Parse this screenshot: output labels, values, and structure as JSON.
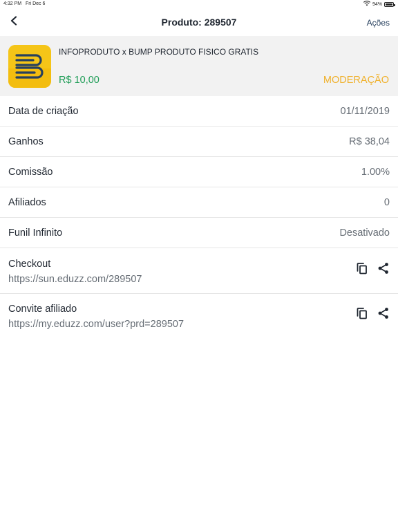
{
  "status_bar": {
    "time": "4:32 PM",
    "date": "Fri Dec 6",
    "battery": "94%"
  },
  "nav": {
    "title": "Produto: 289507",
    "actions_label": "Ações"
  },
  "product": {
    "name": "INFOPRODUTO x BUMP PRODUTO FISICO GRATIS",
    "price": "R$ 10,00",
    "status": "MODERAÇÃO"
  },
  "details": [
    {
      "label": "Data de criação",
      "value": "01/11/2019"
    },
    {
      "label": "Ganhos",
      "value": "R$ 38,04"
    },
    {
      "label": "Comissão",
      "value": "1.00%"
    },
    {
      "label": "Afiliados",
      "value": "0"
    },
    {
      "label": "Funil Infinito",
      "value": "Desativado"
    }
  ],
  "links": [
    {
      "label": "Checkout",
      "url": "https://sun.eduzz.com/289507"
    },
    {
      "label": "Convite afiliado",
      "url": "https://my.eduzz.com/user?prd=289507"
    }
  ],
  "colors": {
    "price": "#1f9d57",
    "status": "#f0b12b",
    "header_bg": "#f2f2f2",
    "logo_bg": "#f5c518",
    "logo_mark": "#27405e"
  },
  "icons": {
    "back": "chevron-left-icon",
    "wifi": "wifi-icon",
    "battery": "battery-icon",
    "copy": "copy-icon",
    "share": "share-icon"
  }
}
